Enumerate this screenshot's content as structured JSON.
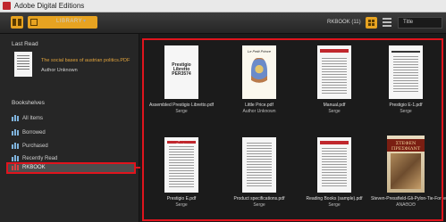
{
  "app": {
    "title": "Adobe Digital Editions"
  },
  "toolbar": {
    "library_label": "LIBRARY",
    "shelf_name": "RKBOOK (11)",
    "sort_value": "Title"
  },
  "sidebar": {
    "last_read_title": "Last Read",
    "last_read_book": {
      "title": "The social bases of austrian politics.PDF",
      "author": "Author Unknown"
    },
    "bookshelves_title": "Bookshelves",
    "shelves": [
      {
        "label": "All Items"
      },
      {
        "label": "Borrowed"
      },
      {
        "label": "Purchased"
      },
      {
        "label": "Recently Read"
      },
      {
        "label": "RKBOOK"
      }
    ]
  },
  "books": [
    {
      "title": "Assembled Prestigio Libretto.pdf",
      "author": "Serge",
      "cover_text": "Prestigio Libretto PER3574"
    },
    {
      "title": "Little Price.pdf",
      "author": "Author Unknown",
      "cover_text": "Le Petit Prince"
    },
    {
      "title": "Manual.pdf",
      "author": "Serge",
      "cover_text": ""
    },
    {
      "title": "Prestigio E-1.pdf",
      "author": "Serge",
      "cover_text": ""
    },
    {
      "title": "Prestigio E.pdf",
      "author": "Serge",
      "cover_text": "Prestigio E-book Reader"
    },
    {
      "title": "Product specifications.pdf",
      "author": "Serge",
      "cover_text": ""
    },
    {
      "title": "Reading Books (sample).pdf",
      "author": "Serge",
      "cover_text": ""
    },
    {
      "title": "Steven-Pressfield-Gli-Pylon-Tie-Forces.pdf",
      "author": "ΑΝΑΘΩΘ",
      "cover_text": "ΣΤΕΦΕΝ ΠΡΕΣΦΙΛΝΤ ΘΥΕΛΛΑ ΤΙΣ ΠΥΛΕΣ"
    }
  ],
  "colors": {
    "accent": "#e7a321",
    "highlight": "#e0141d",
    "link": "#e2a43c"
  }
}
